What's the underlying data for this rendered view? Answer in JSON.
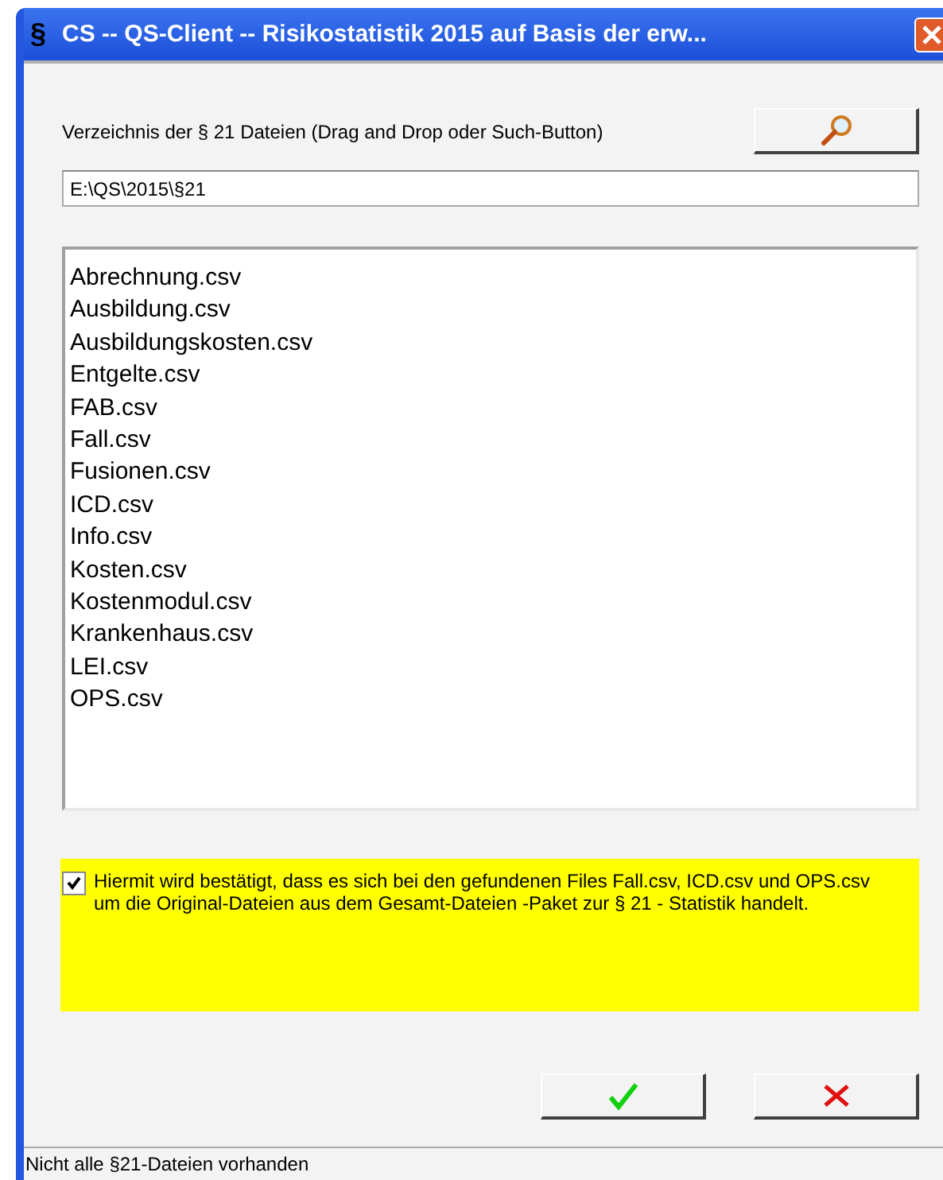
{
  "window": {
    "icon_glyph": "§",
    "title": "CS  --  QS-Client  --  Risikostatistik 2015 auf Basis der erw..."
  },
  "directory": {
    "label": "Verzeichnis der § 21 Dateien (Drag and Drop oder Such-Button)",
    "value": "E:\\QS\\2015\\§21"
  },
  "files": [
    "Abrechnung.csv",
    "Ausbildung.csv",
    "Ausbildungskosten.csv",
    "Entgelte.csv",
    "FAB.csv",
    "Fall.csv",
    "Fusionen.csv",
    "ICD.csv",
    "Info.csv",
    "Kosten.csv",
    "Kostenmodul.csv",
    "Krankenhaus.csv",
    "LEI.csv",
    "OPS.csv"
  ],
  "confirmation": {
    "checked": true,
    "text": "Hiermit wird bestätigt, dass es sich bei den gefundenen Files Fall.csv, ICD.csv und OPS.csv um die Original-Dateien aus dem Gesamt-Dateien -Paket zur § 21 - Statistik handelt."
  },
  "status_bar": "Nicht alle §21-Dateien vorhanden"
}
